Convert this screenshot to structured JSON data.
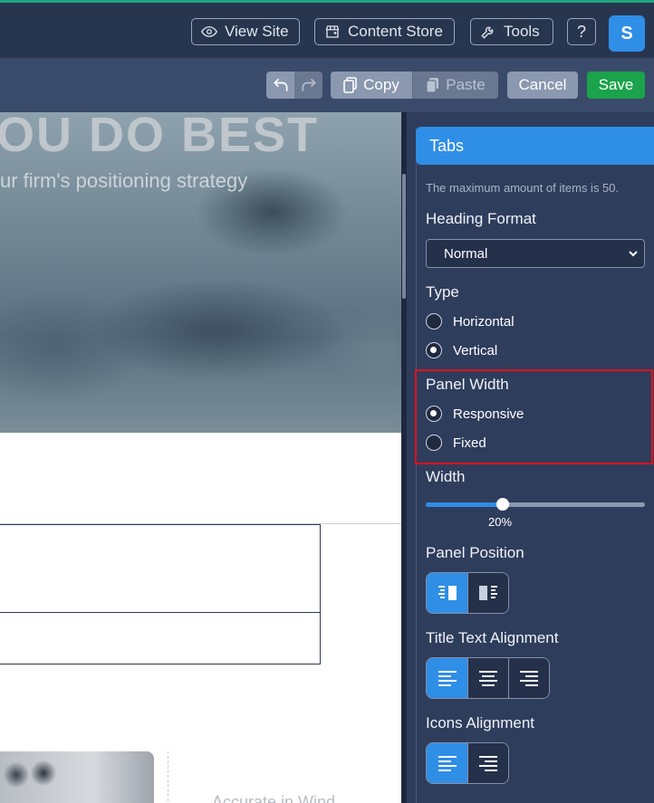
{
  "topbar": {
    "view_site": "View Site",
    "content_store": "Content Store",
    "tools": "Tools",
    "help": "?",
    "avatar": "S"
  },
  "toolbar": {
    "copy": "Copy",
    "paste": "Paste",
    "cancel": "Cancel",
    "save": "Save"
  },
  "canvas": {
    "hero_title": "OU DO BEST",
    "hero_subtitle": "ur firm's positioning strategy",
    "blur_text": "Accurate in Wind"
  },
  "panel": {
    "title": "Tabs",
    "note": "The maximum amount of items is 50.",
    "heading_format": {
      "label": "Heading Format",
      "value": "Normal"
    },
    "type": {
      "label": "Type",
      "options": [
        "Horizontal",
        "Vertical"
      ],
      "selected": "Vertical"
    },
    "panel_width": {
      "label": "Panel Width",
      "options": [
        "Responsive",
        "Fixed"
      ],
      "selected": "Responsive"
    },
    "width": {
      "label": "Width",
      "value": "20%",
      "fraction": 0.35
    },
    "panel_position": {
      "label": "Panel Position",
      "icons": [
        "panel-left-icon",
        "panel-right-icon"
      ],
      "selected": 0
    },
    "title_text_alignment": {
      "label": "Title Text Alignment",
      "icons": [
        "align-left-icon",
        "align-center-icon",
        "align-right-icon"
      ],
      "selected": 0
    },
    "icons_alignment": {
      "label": "Icons Alignment",
      "icons": [
        "align-left-icon",
        "align-right-icon"
      ],
      "selected": 0
    }
  },
  "colors": {
    "accent": "#2f8ee6",
    "save": "#1aa34a",
    "highlight": "#e3101b"
  }
}
